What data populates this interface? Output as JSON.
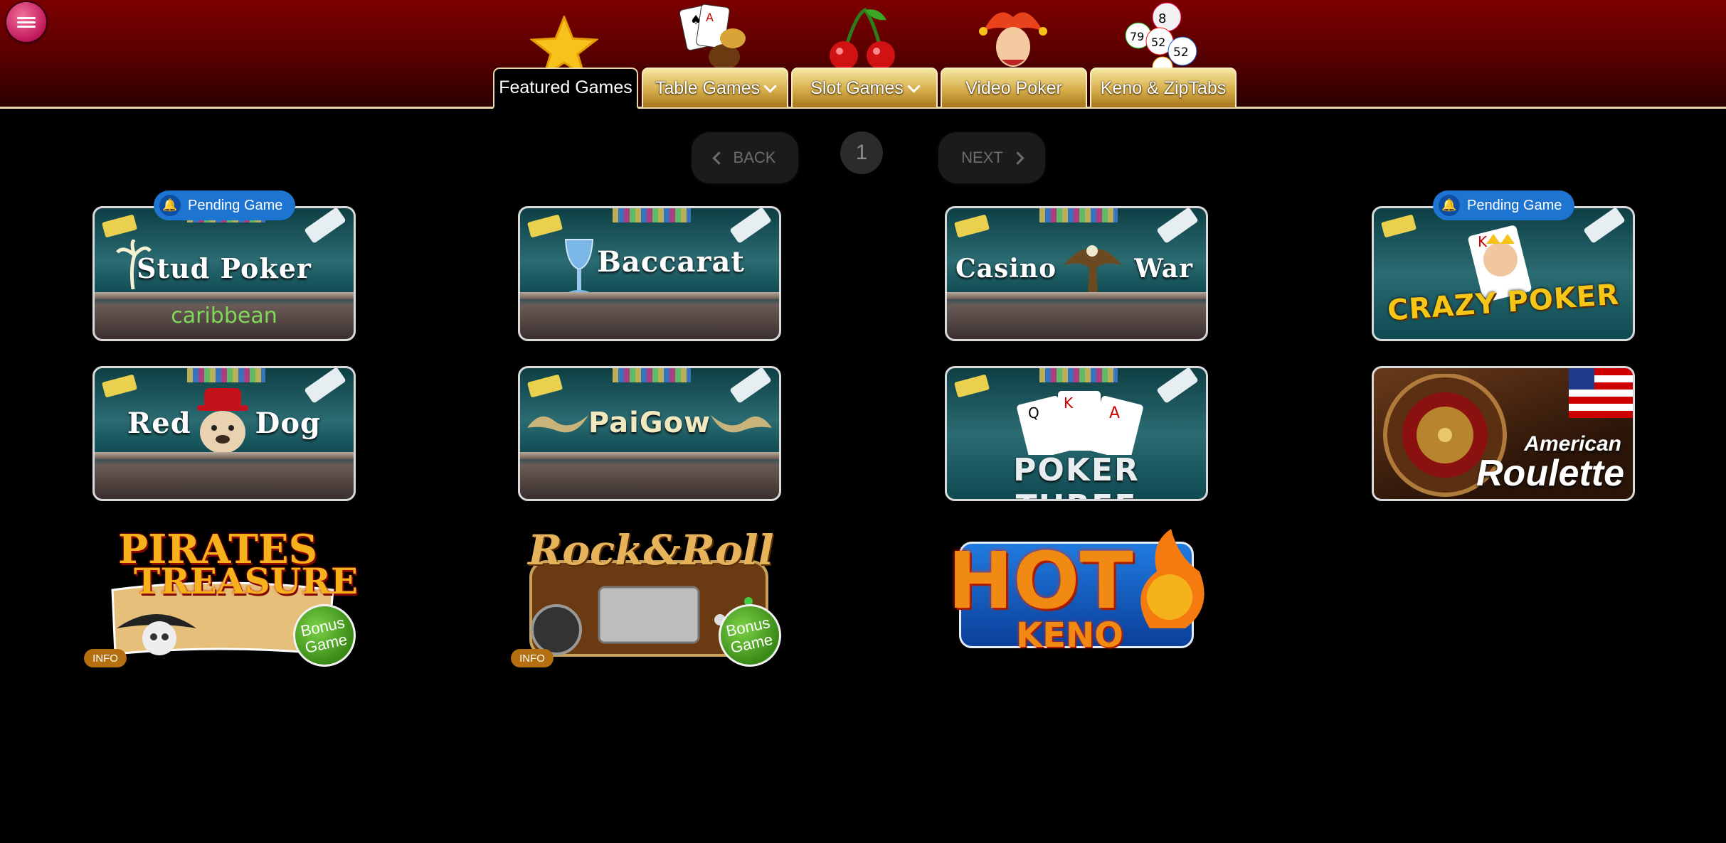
{
  "header": {
    "menu_icon": "hamburger-menu-icon",
    "tabs": [
      {
        "label": "Featured Games",
        "icon": "star-icon",
        "active": true,
        "dropdown": false
      },
      {
        "label": "Table Games",
        "icon": "playing-cards-icon",
        "active": false,
        "dropdown": true
      },
      {
        "label": "Slot Games",
        "icon": "cherries-icon",
        "active": false,
        "dropdown": true
      },
      {
        "label": "Video Poker",
        "icon": "jester-icon",
        "active": false,
        "dropdown": false
      },
      {
        "label": "Keno & ZipTabs",
        "icon": "bingo-balls-icon",
        "active": false,
        "dropdown": false
      }
    ]
  },
  "pagination": {
    "back": "BACK",
    "page": "1",
    "next": "NEXT"
  },
  "games": {
    "stud_poker": {
      "title": "Stud Poker",
      "subtitle": "caribbean",
      "badge": "Pending Game"
    },
    "baccarat": {
      "title": "Baccarat"
    },
    "casino_war": {
      "title_left": "Casino",
      "title_right": "War"
    },
    "crazy_poker": {
      "title": "CRAZY POKER",
      "badge": "Pending Game"
    },
    "red_dog": {
      "title_left": "Red",
      "title_right": "Dog"
    },
    "pai_gow": {
      "title": "PaiGow"
    },
    "poker_three": {
      "title": "POKER THREE"
    },
    "american_roulette": {
      "line1": "American",
      "line2": "Roulette"
    },
    "pirates_treasure": {
      "line1": "PIRATES",
      "line2": "TREASURE",
      "bonus": "Bonus Game",
      "info": "INFO"
    },
    "rock_roll": {
      "title": "Rock&Roll",
      "bonus": "Bonus Game",
      "info": "INFO"
    },
    "hot_keno": {
      "line1": "HOT",
      "line2": "KENO"
    }
  },
  "colors": {
    "header_red": "#7d0000",
    "tab_gold": "#d6ad4a",
    "badge_blue": "#1e74d1",
    "bonus_green": "#4a9c20",
    "info_orange": "#b36f10"
  }
}
